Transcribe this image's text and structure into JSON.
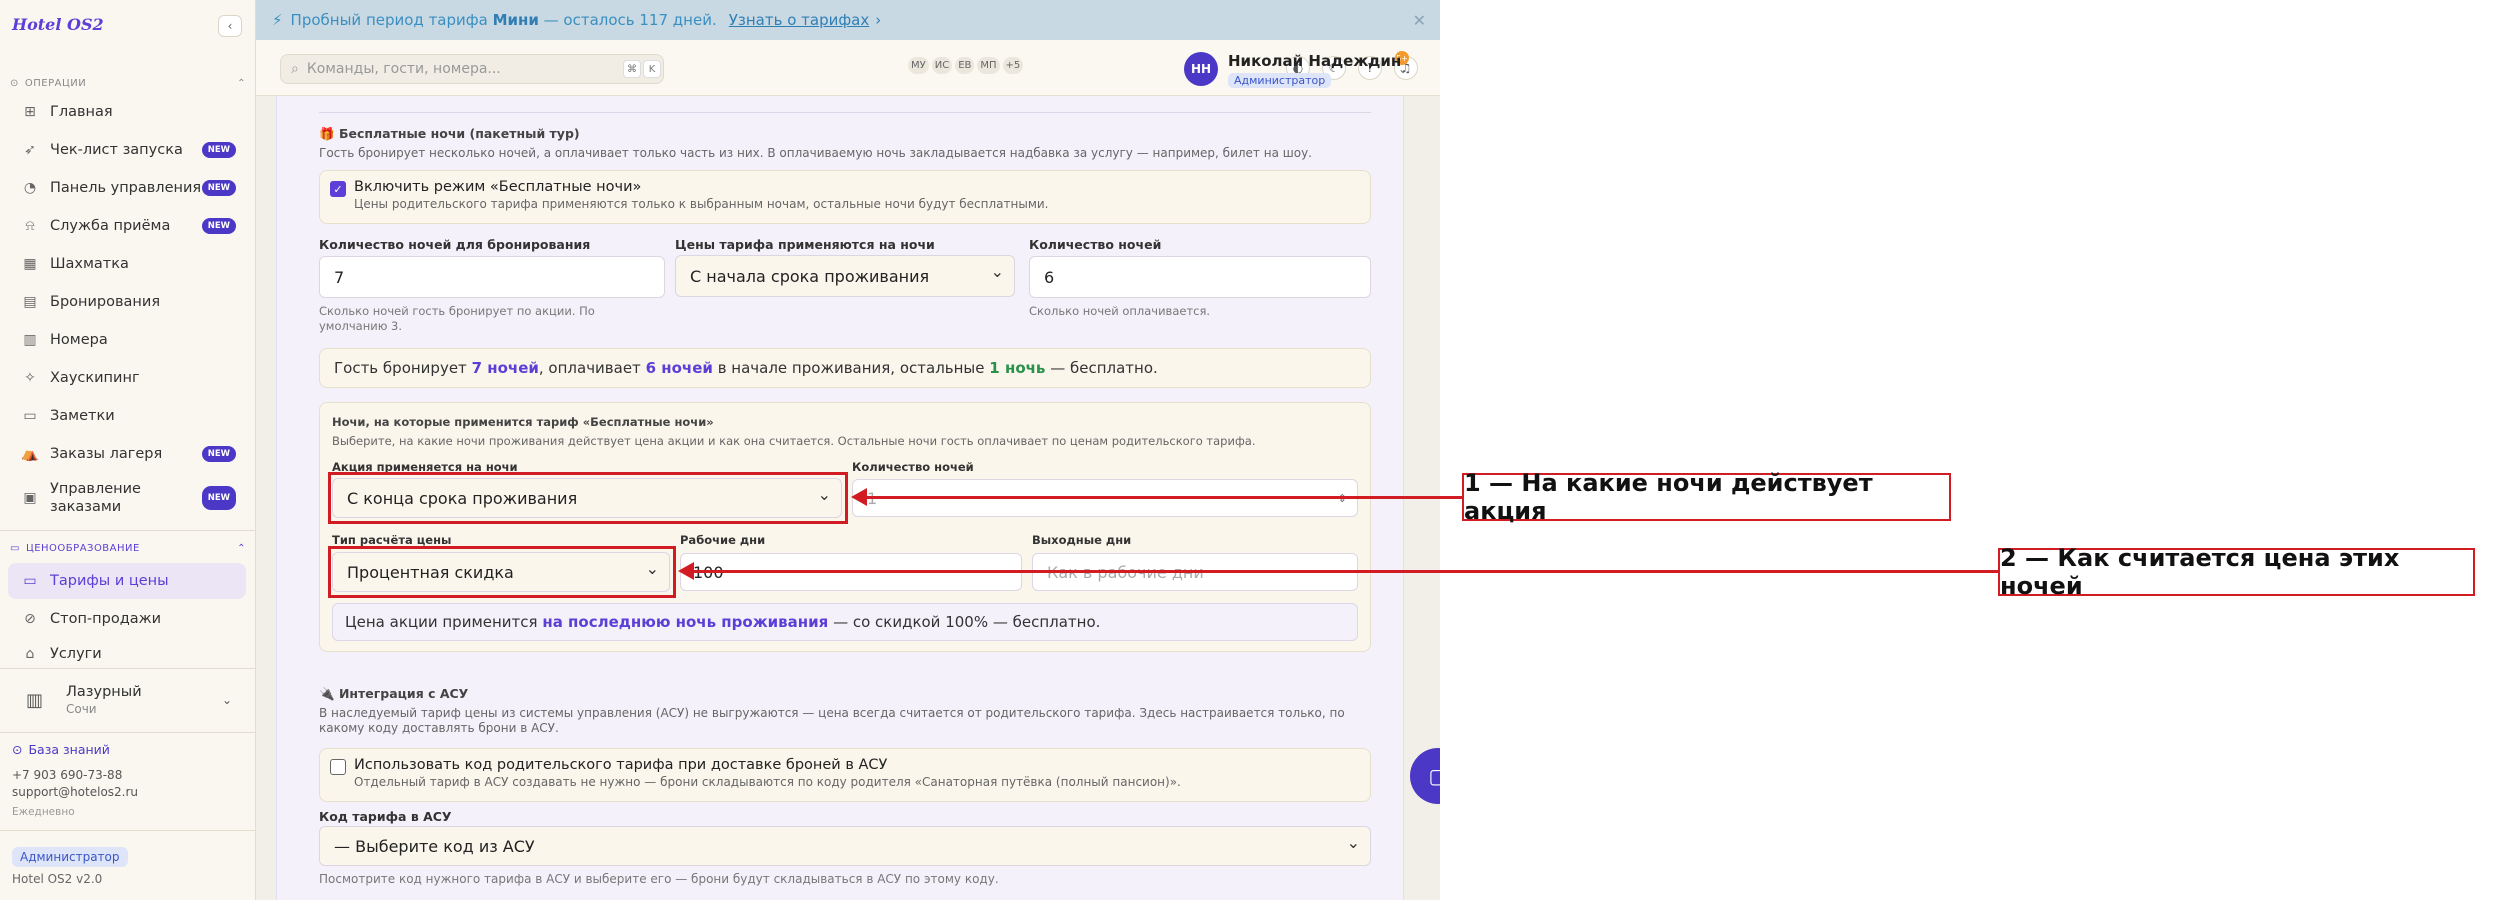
{
  "app": {
    "logo": "Hotel OS2"
  },
  "sidebar": {
    "ops_title": "ОПЕРАЦИИ",
    "items": [
      {
        "label": "Главная",
        "icon": "grid-icon"
      },
      {
        "label": "Чек-лист запуска",
        "icon": "rocket-icon",
        "badge": "NEW"
      },
      {
        "label": "Панель управления",
        "icon": "gauge-icon",
        "badge": "NEW"
      },
      {
        "label": "Служба приёма",
        "icon": "bell-icon",
        "badge": "NEW"
      },
      {
        "label": "Шахматка",
        "icon": "table-icon"
      },
      {
        "label": "Бронирования",
        "icon": "clipboard-icon"
      },
      {
        "label": "Номера",
        "icon": "building-icon"
      },
      {
        "label": "Хаускипинг",
        "icon": "sparkles-icon"
      },
      {
        "label": "Заметки",
        "icon": "note-icon"
      },
      {
        "label": "Заказы лагеря",
        "icon": "tent-icon",
        "badge": "NEW"
      },
      {
        "label": "Управление заказами",
        "icon": "orders-icon",
        "badge": "NEW"
      }
    ],
    "pricing_title": "ЦЕНООБРАЗОВАНИЕ",
    "pricing_items": [
      {
        "label": "Тарифы и цены",
        "icon": "rates-icon"
      },
      {
        "label": "Стоп-продажи",
        "icon": "ban-icon"
      },
      {
        "label": "Услуги",
        "icon": "tag-icon"
      }
    ],
    "hotel": {
      "name": "Лазурный",
      "city": "Сочи"
    },
    "kb_label": "База знаний",
    "phone": "+7 903 690-73-88",
    "email": "support@hotelos2.ru",
    "schedule": "Ежедневно",
    "role": "Администратор",
    "version": "Hotel OS2 v2.0"
  },
  "banner": {
    "prefix": "Пробный период тарифа",
    "plan": "Мини",
    "suffix": "— осталось 117 дней.",
    "link": "Узнать о тарифах"
  },
  "header": {
    "search_placeholder": "Команды, гости, номера...",
    "kbd1": "⌘",
    "kbd2": "K",
    "avatars": [
      "МУ",
      "ИС",
      "ЕВ",
      "МП",
      "+5"
    ],
    "notif_count": "5+",
    "user_initials": "НН",
    "user_name": "Николай Надеждин",
    "user_role": "Администратор"
  },
  "free_nights": {
    "title": "Бесплатные ночи (пакетный тур)",
    "desc": "Гость бронирует несколько ночей, а оплачивает только часть из них. В оплачиваемую ночь закладывается надбавка за услугу — например, билет на шоу.",
    "enable_label": "Включить режим «Бесплатные ночи»",
    "enable_sub": "Цены родительского тарифа применяются только к выбранным ночам, остальные ночи будут бесплатными.",
    "booking_nights_label": "Количество ночей для бронирования",
    "booking_nights_value": "7",
    "booking_nights_hint": "Сколько ночей гость бронирует по акции. По умолчанию 3.",
    "apply_from_label": "Цены тарифа применяются на ночи",
    "apply_from_value": "С начала срока проживания",
    "paid_nights_label": "Количество ночей",
    "paid_nights_value": "6",
    "paid_nights_hint": "Сколько ночей оплачивается.",
    "summary_a": "Гость бронирует",
    "summary_b": "7 ночей",
    "summary_c": ", оплачивает",
    "summary_d": "6 ночей",
    "summary_e": "в начале проживания, остальные",
    "summary_f": "1 ночь",
    "summary_g": "— бесплатно."
  },
  "promo_nights": {
    "title": "Ночи, на которые применится тариф «Бесплатные ночи»",
    "desc": "Выберите, на какие ночи проживания действует цена акции и как она считается. Остальные ночи гость оплачивает по ценам родительского тарифа.",
    "applies_label": "Акция применяется на ночи",
    "applies_value": "С конца срока проживания",
    "count_label": "Количество ночей",
    "count_value": "1",
    "calc_label": "Тип расчёта цены",
    "calc_value": "Процентная скидка",
    "weekdays_label": "Рабочие дни",
    "weekdays_value": "100",
    "weekend_label": "Выходные дни",
    "weekend_placeholder": "Как в рабочие дни",
    "summary_a": "Цена акции применится",
    "summary_b": "на последнюю ночь проживания",
    "summary_c": "— со скидкой 100% — бесплатно."
  },
  "integration": {
    "title": "Интеграция с АСУ",
    "desc": "В наследуемый тариф цены из системы управления (АСУ) не выгружаются — цена всегда считается от родительского тарифа. Здесь настраивается только, по какому коду доставлять брони в АСУ.",
    "use_parent_label": "Использовать код родительского тарифа при доставке броней в АСУ",
    "use_parent_sub": "Отдельный тариф в АСУ создавать не нужно — брони складываются по коду родителя «Санаторная путёвка (полный пансион)».",
    "code_label": "Код тарифа в АСУ",
    "code_value": "— Выберите код из АСУ",
    "code_hint": "Посмотрите код нужного тарифа в АСУ и выберите его — брони будут складываться в АСУ по этому коду."
  },
  "annotations": {
    "callout1": "1 — На какие ночи действует акция",
    "callout2": "2 — Как считается цена этих ночей",
    "color": "#d21c24"
  }
}
